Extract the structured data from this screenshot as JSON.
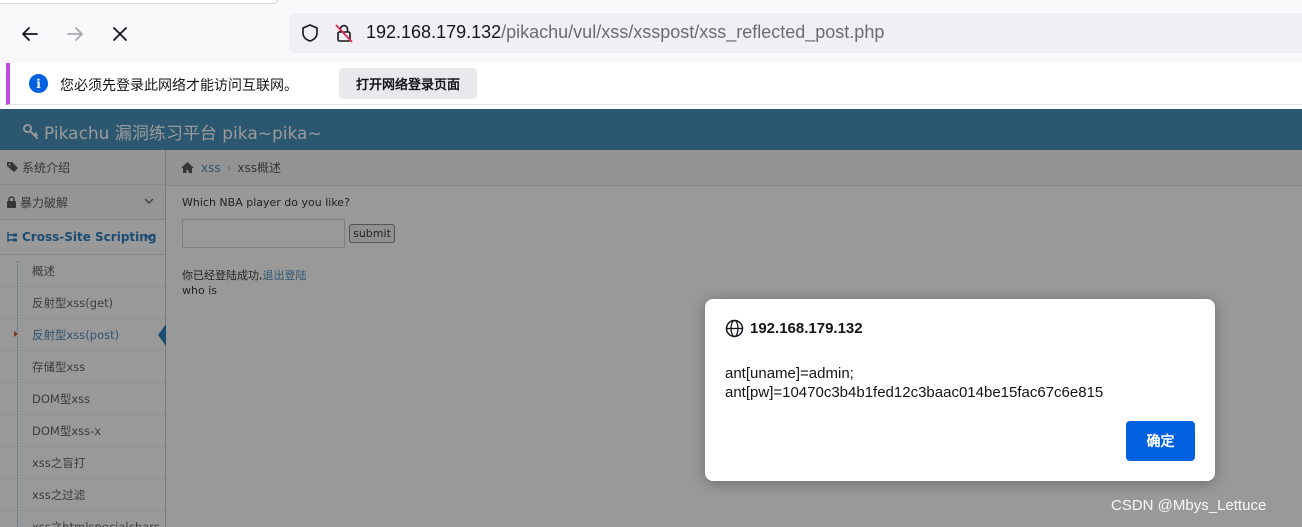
{
  "browser": {
    "url_host": "192.168.179.132",
    "url_path": "/pikachu/vul/xss/xsspost/xss_reflected_post.php"
  },
  "notification": {
    "message": "您必须先登录此网络才能访问互联网。",
    "button_label": "打开网络登录页面"
  },
  "app": {
    "brand": "Pikachu 漏洞练习平台 pika~pika~"
  },
  "sidebar": {
    "items": [
      {
        "label": "系统介绍",
        "icon": "tags-icon"
      },
      {
        "label": "暴力破解",
        "icon": "lock-icon"
      },
      {
        "label": "Cross-Site Scripting",
        "icon": "sitemap-icon"
      }
    ],
    "subitems": [
      {
        "label": "概述"
      },
      {
        "label": "反射型xss(get)"
      },
      {
        "label": "反射型xss(post)"
      },
      {
        "label": "存储型xss"
      },
      {
        "label": "DOM型xss"
      },
      {
        "label": "DOM型xss-x"
      },
      {
        "label": "xss之盲打"
      },
      {
        "label": "xss之过滤"
      },
      {
        "label": "xss之htmlspecialchars"
      }
    ]
  },
  "breadcrumb": {
    "link": "xss",
    "current": "xss概述"
  },
  "form": {
    "question": "Which NBA player do you like?",
    "input_value": "",
    "submit_label": "submit",
    "login_message": "你已经登陆成功,",
    "logout_link": "退出登陆",
    "who_is": "who is"
  },
  "dialog": {
    "origin": "192.168.179.132",
    "message_line1": "ant[uname]=admin;",
    "message_line2": "ant[pw]=10470c3b4b1fed12c3baac014be15fac67c6e815",
    "ok_label": "确定"
  },
  "watermark": "CSDN @Mbys_Lettuce",
  "colors": {
    "navbar": "#438eb9",
    "accent_blue": "#0061e0",
    "notification_accent": "#c04bd6"
  }
}
